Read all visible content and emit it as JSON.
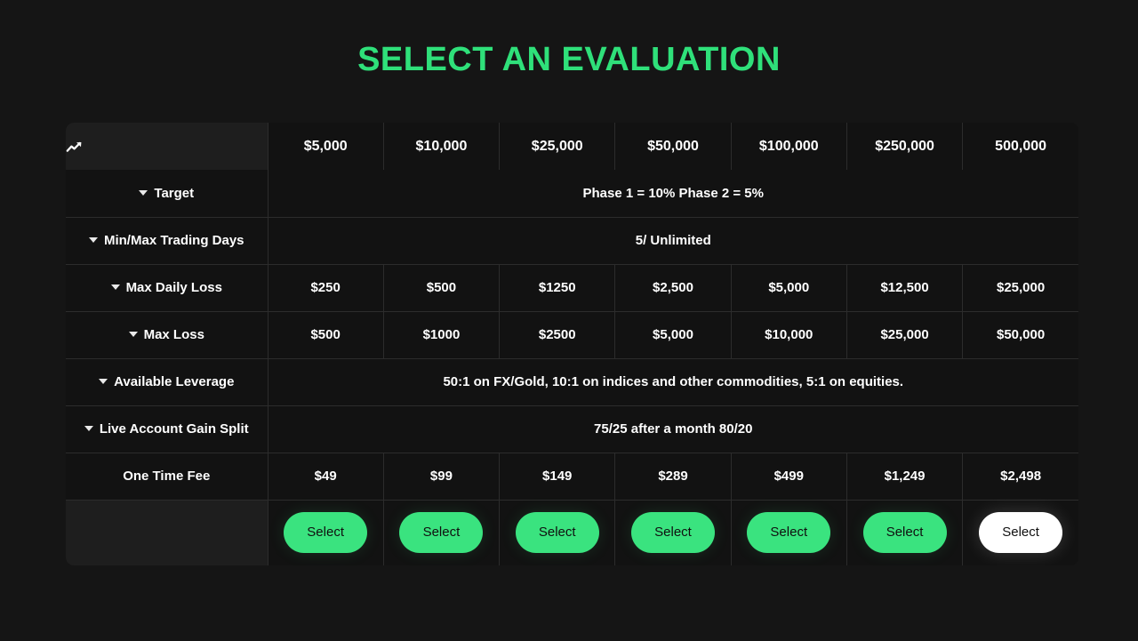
{
  "title": "SELECT AN EVALUATION",
  "accent_color": "#2fe07a",
  "button_color": "#3ae37f",
  "button_active_color": "#ffffff",
  "page_background": "#151515",
  "table": {
    "header": {
      "corner_icon": "trending-up-icon",
      "columns": [
        "$5,000",
        "$10,000",
        "$25,000",
        "$50,000",
        "$100,000",
        "$250,000",
        "500,000"
      ]
    },
    "rows": [
      {
        "label": "Target",
        "has_caret": true,
        "merged": true,
        "merged_value": "Phase 1 = 10% Phase 2 = 5%"
      },
      {
        "label": "Min/Max Trading Days",
        "has_caret": true,
        "merged": true,
        "merged_value": "5/ Unlimited"
      },
      {
        "label": "Max Daily Loss",
        "has_caret": true,
        "merged": false,
        "values": [
          "$250",
          "$500",
          "$1250",
          "$2,500",
          "$5,000",
          "$12,500",
          "$25,000"
        ]
      },
      {
        "label": "Max Loss",
        "has_caret": true,
        "merged": false,
        "values": [
          "$500",
          "$1000",
          "$2500",
          "$5,000",
          "$10,000",
          "$25,000",
          "$50,000"
        ]
      },
      {
        "label": "Available Leverage",
        "has_caret": true,
        "merged": true,
        "merged_value": "50:1 on FX/Gold, 10:1 on indices and other commodities, 5:1 on equities."
      },
      {
        "label": "Live Account Gain Split",
        "has_caret": true,
        "merged": true,
        "merged_value": "75/25 after a month 80/20"
      },
      {
        "label": "One Time Fee",
        "has_caret": false,
        "merged": false,
        "values": [
          "$49",
          "$99",
          "$149",
          "$289",
          "$499",
          "$1,249",
          "$2,498"
        ]
      }
    ],
    "action_row": {
      "label": "",
      "buttons": [
        {
          "label": "Select",
          "active": false
        },
        {
          "label": "Select",
          "active": false
        },
        {
          "label": "Select",
          "active": false
        },
        {
          "label": "Select",
          "active": false
        },
        {
          "label": "Select",
          "active": false
        },
        {
          "label": "Select",
          "active": false
        },
        {
          "label": "Select",
          "active": true
        }
      ]
    }
  }
}
